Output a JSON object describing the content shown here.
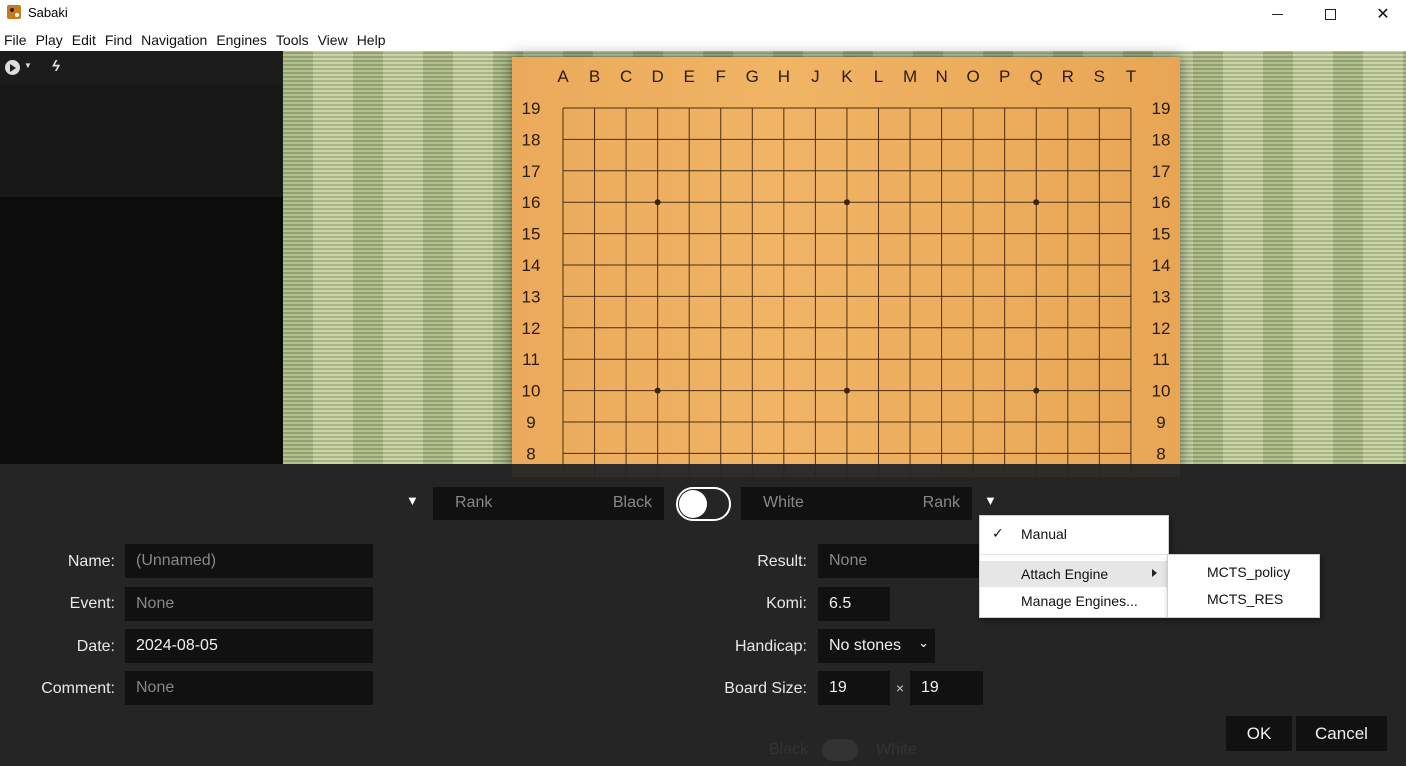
{
  "window": {
    "title": "Sabaki"
  },
  "menu": [
    "File",
    "Play",
    "Edit",
    "Find",
    "Navigation",
    "Engines",
    "Tools",
    "View",
    "Help"
  ],
  "board": {
    "columns": [
      "A",
      "B",
      "C",
      "D",
      "E",
      "F",
      "G",
      "H",
      "J",
      "K",
      "L",
      "M",
      "N",
      "O",
      "P",
      "Q",
      "R",
      "S",
      "T"
    ],
    "rows": [
      "19",
      "18",
      "17",
      "16",
      "15",
      "14",
      "13",
      "12",
      "11",
      "10",
      "9",
      "8"
    ]
  },
  "players": {
    "black": {
      "rank_placeholder": "Rank",
      "name_placeholder": "Black"
    },
    "white": {
      "name_placeholder": "White",
      "rank_placeholder": "Rank"
    }
  },
  "fields": {
    "name": {
      "label": "Name:",
      "placeholder": "(Unnamed)"
    },
    "event": {
      "label": "Event:",
      "placeholder": "None"
    },
    "date": {
      "label": "Date:",
      "value": "2024-08-05"
    },
    "comment": {
      "label": "Comment:",
      "placeholder": "None"
    },
    "result": {
      "label": "Result:",
      "placeholder": "None"
    },
    "komi": {
      "label": "Komi:",
      "value": "6.5"
    },
    "handicap": {
      "label": "Handicap:",
      "value": "No stones"
    },
    "board_size": {
      "label": "Board Size:",
      "width": "19",
      "times": "×",
      "height": "19"
    }
  },
  "buttons": {
    "ok": "OK",
    "cancel": "Cancel"
  },
  "underlay": {
    "black": "Black",
    "white": "White"
  },
  "engine_menu": {
    "items": [
      "Manual",
      "Attach Engine",
      "Manage Engines..."
    ],
    "submenu": [
      "MCTS_policy",
      "MCTS_RES"
    ]
  }
}
